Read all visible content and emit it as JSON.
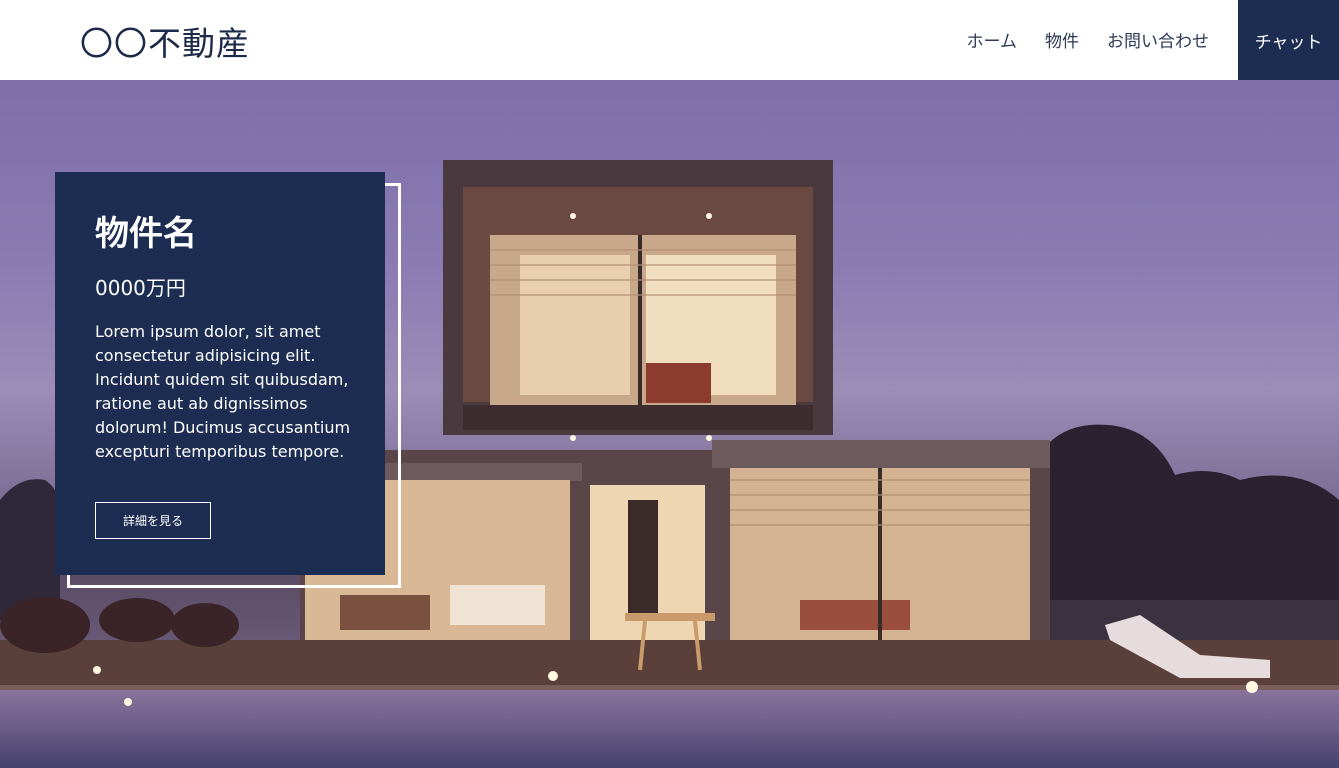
{
  "header": {
    "logo": "〇〇不動産",
    "nav": [
      {
        "label": "ホーム"
      },
      {
        "label": "物件"
      },
      {
        "label": "お問い合わせ"
      }
    ],
    "chat_label": "チャット"
  },
  "property": {
    "name": "物件名",
    "price": "0000万円",
    "description": "Lorem ipsum dolor, sit amet consectetur adipisicing elit. Incidunt quidem sit quibusdam, ratione aut ab dignissimos dolorum! Ducimus accusantium excepturi temporibus tempore.",
    "detail_button": "詳細を見る"
  },
  "colors": {
    "brand": "#1d2d52",
    "header_bg": "#ffffff",
    "nav_text": "#2d3a55"
  },
  "hero_image": "modern-house-dusk-with-pool"
}
